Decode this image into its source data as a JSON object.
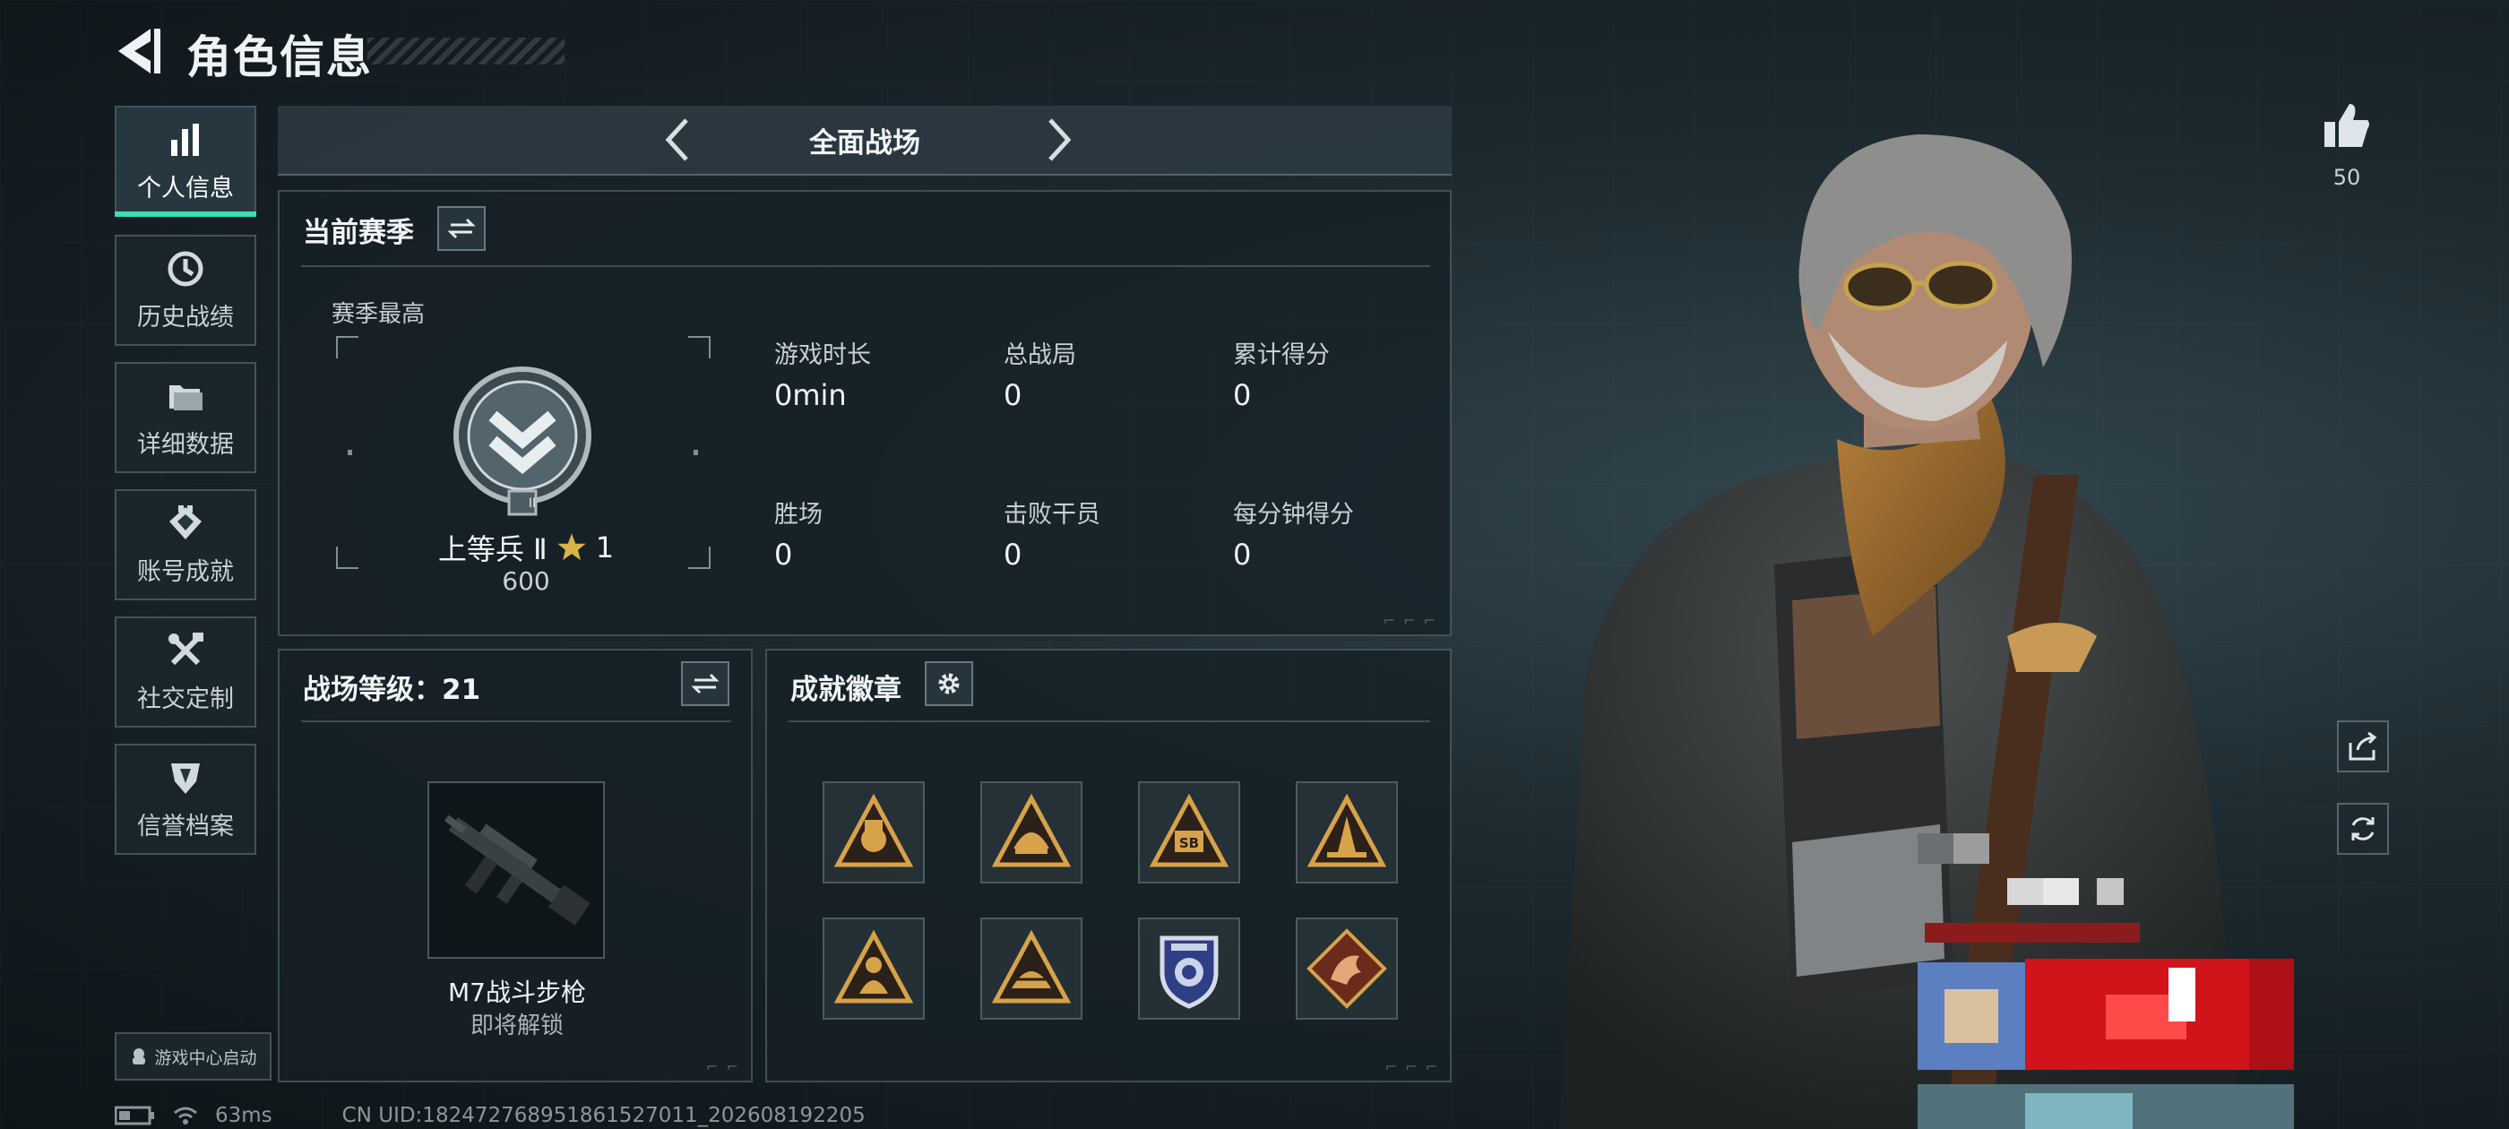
{
  "header": {
    "title": "角色信息",
    "back_icon": "back-arrow-icon"
  },
  "sidebar": {
    "items": [
      {
        "label": "个人信息",
        "icon": "bar-chart-icon",
        "active": true
      },
      {
        "label": "历史战绩",
        "icon": "history-clock-icon",
        "active": false
      },
      {
        "label": "详细数据",
        "icon": "folder-icon",
        "active": false
      },
      {
        "label": "账号成就",
        "icon": "achievement-icon",
        "active": false
      },
      {
        "label": "社交定制",
        "icon": "tools-icon",
        "active": false
      },
      {
        "label": "信誉档案",
        "icon": "shield-icon",
        "active": false
      }
    ],
    "launch_label": "游戏中心启动"
  },
  "mode": {
    "label": "全面战场"
  },
  "season": {
    "title": "当前赛季",
    "best_label": "赛季最高",
    "rank_name": "上等兵 Ⅱ",
    "rank_stars": "1",
    "rank_points": "600",
    "rank_level_mark": "II",
    "stats": [
      {
        "label": "游戏时长",
        "value": "0min"
      },
      {
        "label": "总战局",
        "value": "0"
      },
      {
        "label": "累计得分",
        "value": "0"
      },
      {
        "label": "胜场",
        "value": "0"
      },
      {
        "label": "击败干员",
        "value": "0"
      },
      {
        "label": "每分钟得分",
        "value": "0"
      }
    ]
  },
  "level": {
    "title": "战场等级：21",
    "weapon_name": "M7战斗步枪",
    "weapon_status": "即将解锁"
  },
  "badges": {
    "title": "成就徽章",
    "items": [
      {
        "icon": "badge-fist-icon",
        "text": ""
      },
      {
        "icon": "badge-helmet-icon",
        "text": ""
      },
      {
        "icon": "badge-sb-icon",
        "text": "SB"
      },
      {
        "icon": "badge-tower-icon",
        "text": ""
      },
      {
        "icon": "badge-soldier-icon",
        "text": ""
      },
      {
        "icon": "badge-dome-icon",
        "text": ""
      },
      {
        "icon": "badge-lion-shield-icon",
        "text": ""
      },
      {
        "icon": "badge-dragon-icon",
        "text": ""
      }
    ]
  },
  "likes": {
    "count": "50"
  },
  "status_bar": {
    "ping": "63ms",
    "uid": "CN UID:1824727689518615270​11_202608192205"
  },
  "colors": {
    "accent": "#36e0b4",
    "badge_gold": "#d6a24a",
    "panel_border": "#5c707a"
  }
}
